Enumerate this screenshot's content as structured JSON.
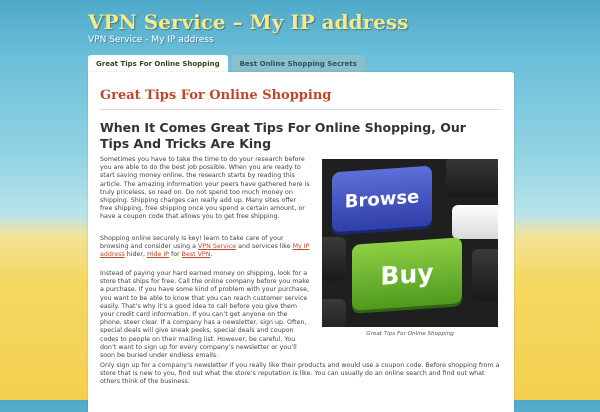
{
  "site": {
    "title": "VPN Service – My IP address",
    "description": "VPN Service - My IP address"
  },
  "nav": {
    "tabs": [
      {
        "label": "Great Tips For Online Shopping",
        "active": true
      },
      {
        "label": "Best Online Shopping Secrets",
        "active": false
      }
    ]
  },
  "page": {
    "title": "Great Tips For Online Shopping",
    "post_title": "When It Comes Great Tips For Online Shopping, Our Tips And Tricks Are King",
    "p1": "Sometimes you have to take the time to do your research before you are able to do the best job possible. When you are ready to start saving money online, the research starts by reading this article. The amazing information your peers have gathered here is truly priceless, so read on. Do not spend too much money on shipping. Shipping charges can really add up. Many sites offer free shipping, free shipping once you spend a certain amount, or have a coupon code that allows you to get free shipping.",
    "p2_before": "Shopping online securely is key! learn to take care of your browsing and consider using a ",
    "p2_link1": "VPN Service",
    "p2_mid1": " and services like ",
    "p2_link2": "My IP address",
    "p2_mid2": " hider, ",
    "p2_link3": "Hide IP",
    "p2_mid3": " for ",
    "p2_link4": "Best VPN",
    "p2_end": ".",
    "p3": "Instead of paying your hard earned money on shipping, look for a store that ships for free. Call the online company before you make a purchase. If you have some kind of problem with your purchase, you want to be able to know that you can reach customer service easily. That’s why it’s a good idea to call before you give them your credit card information. If you can’t get anyone on the phone, steer clear. If a company has a newsletter, sign up. Often, special deals will give sneak peeks, special deals and coupon codes to people on their mailing list. However, be careful. You don’t want to sign up for every company’s newsletter or you’ll soon be buried under endless emails.",
    "p4": "Only sign up for a company’s newsletter if you really like their products and would use a coupon code. Before shopping from a store that is new to you, find out what the store’s reputation is like. You can usually do an online search and find out what others think of the business."
  },
  "figure": {
    "key1": "Browse",
    "key2": "Buy",
    "caption": "Great Tips For Online Shopping"
  },
  "colors": {
    "accent": "#c0462a",
    "site_title": "#f7e98a",
    "key_blue": "#4452c4",
    "key_green": "#6bb832"
  }
}
